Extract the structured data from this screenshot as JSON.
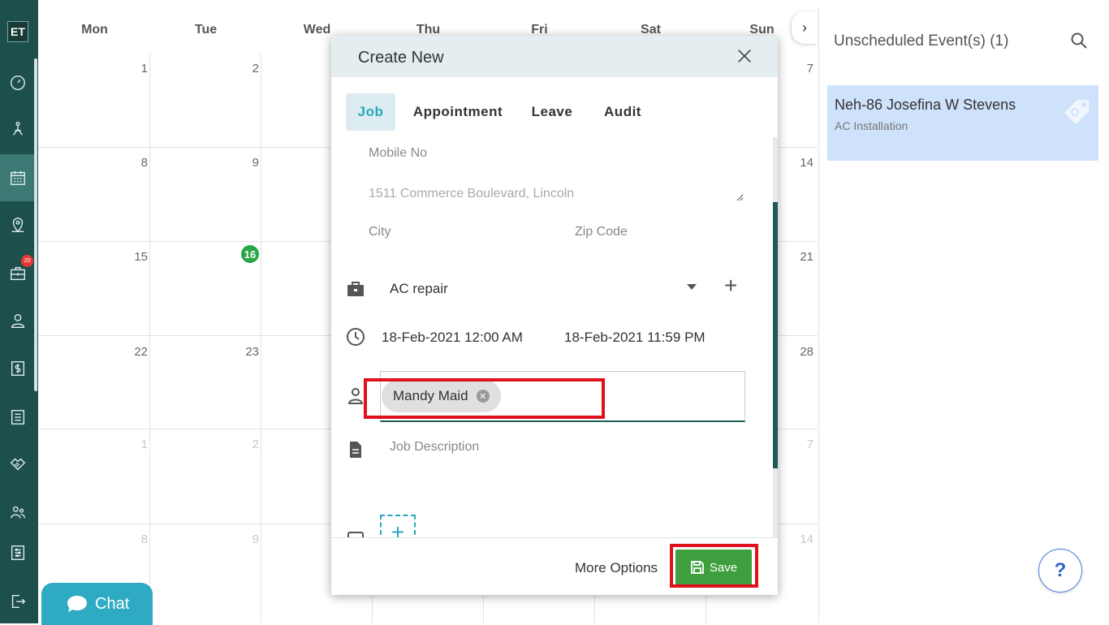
{
  "sidebar": {
    "logo": "ET",
    "badge": "20",
    "icons": [
      "dashboard-icon",
      "network-icon",
      "calendar-icon",
      "map-pin-icon",
      "briefcase-icon",
      "user-icon",
      "dollar-icon",
      "list-icon",
      "handshake-icon",
      "team-icon",
      "sliders-icon",
      "logout-icon"
    ]
  },
  "calendar": {
    "days": [
      "Mon",
      "Tue",
      "Wed",
      "Thu",
      "Fri",
      "Sat",
      "Sun"
    ],
    "rows": [
      {
        "mon": "1",
        "tue": "2",
        "sun": "7"
      },
      {
        "mon": "8",
        "tue": "9",
        "sun": "14"
      },
      {
        "mon": "15",
        "tue": "16",
        "sun": "21"
      },
      {
        "mon": "22",
        "tue": "23",
        "sun": "28"
      },
      {
        "mon": "1",
        "tue": "2",
        "sun": "7"
      },
      {
        "mon": "8",
        "tue": "9",
        "sun": "14"
      }
    ],
    "today": "16",
    "expand_glyph": "›"
  },
  "right_panel": {
    "title": "Unscheduled Event(s) (1)",
    "event": {
      "name": "Neh-86 Josefina W Stevens",
      "type": "AC Installation"
    },
    "help": "?"
  },
  "chat": {
    "label": "Chat"
  },
  "modal": {
    "title": "Create New",
    "tabs": [
      "Job",
      "Appointment",
      "Leave",
      "Audit"
    ],
    "active_tab": "Job",
    "mobile_placeholder": "Mobile No",
    "address_placeholder": "1511  Commerce Boulevard, Lincoln",
    "city_placeholder": "City",
    "zip_placeholder": "Zip Code",
    "job_type": "AC repair",
    "start_date": "18-Feb-2021 12:00 AM",
    "end_date": "18-Feb-2021 11:59 PM",
    "assignee": "Mandy Maid",
    "description_placeholder": "Job Description",
    "more_options": "More Options",
    "save": "Save"
  },
  "colors": {
    "sidebar": "#1d4f4c",
    "accent": "#2aa6bd",
    "save": "#3e9f3e",
    "highlight": "#e0101c",
    "event_card": "#cfe2fb",
    "today": "#27a745"
  }
}
